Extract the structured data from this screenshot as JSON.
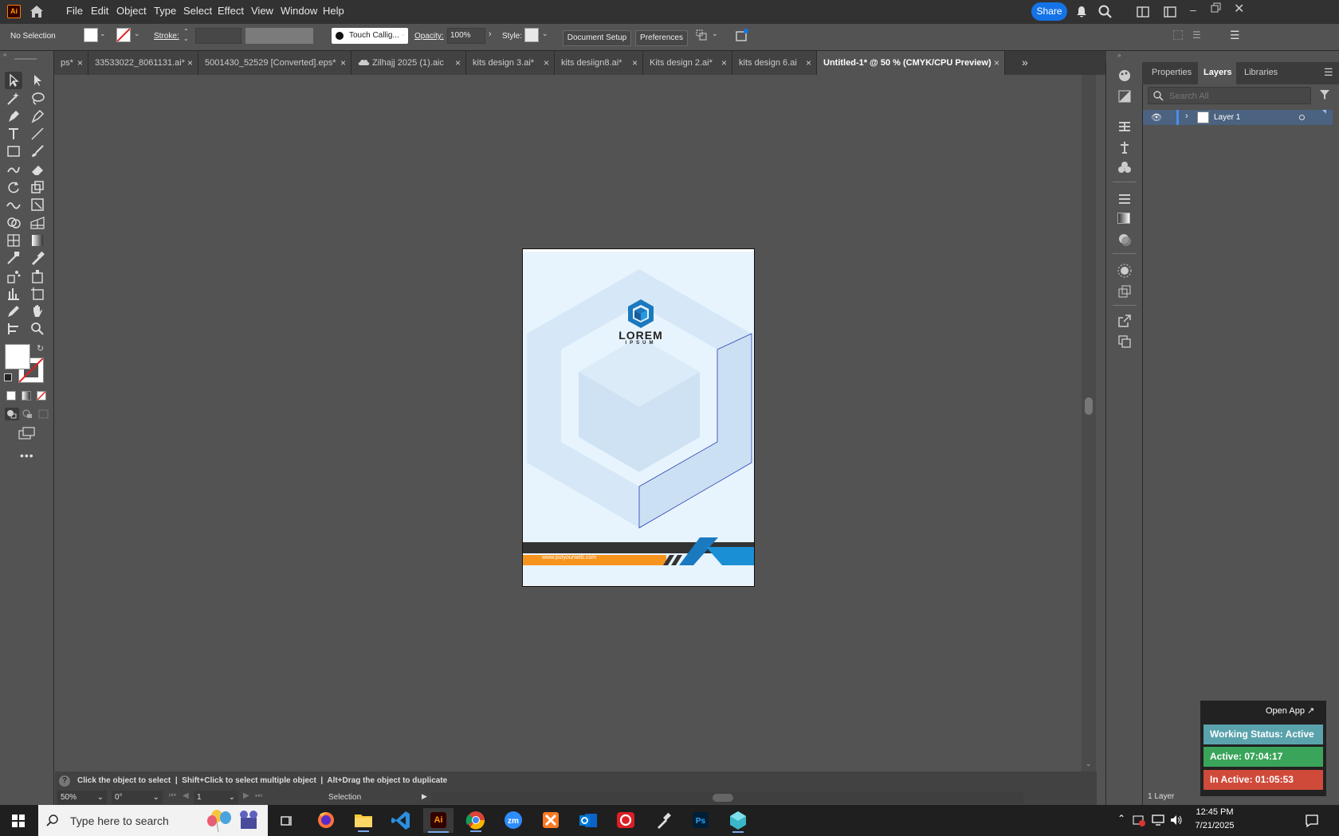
{
  "app": {
    "logo": "Ai"
  },
  "menu": [
    "File",
    "Edit",
    "Object",
    "Type",
    "Select",
    "Effect",
    "View",
    "Window",
    "Help"
  ],
  "header": {
    "share_label": "Share"
  },
  "control": {
    "selection": "No Selection",
    "stroke_label": "Stroke:",
    "brush": "Touch Callig...",
    "opacity_label": "Opacity:",
    "opacity_value": "100%",
    "style_label": "Style:",
    "doc_setup": "Document Setup",
    "preferences": "Preferences"
  },
  "tabs": [
    {
      "label": "ps*"
    },
    {
      "label": "33533022_8061131.ai*"
    },
    {
      "label": "5001430_52529 [Converted].eps*"
    },
    {
      "label": "Zilhajj 2025 (1).aic"
    },
    {
      "label": "kits design 3.ai*"
    },
    {
      "label": "kits desiign8.ai*"
    },
    {
      "label": "Kits design 2.ai*"
    },
    {
      "label": "kits design 6.ai"
    },
    {
      "label": "Untitled-1* @ 50 % (CMYK/CPU Preview)"
    }
  ],
  "artboard": {
    "logo_text_1": "LOREM",
    "logo_text_2": "IPSUM",
    "website": "www.putyourweb.com",
    "colors": {
      "bg": "#e8f4fd",
      "hex_light": "#d3e5f5",
      "blue": "#1b79c0",
      "orange": "#f7941d",
      "dark": "#333333"
    }
  },
  "status": {
    "hint": "Click the object to select  |  Shift+Click to select multiple object  |  Alt+Drag the object to duplicate",
    "zoom": "50%",
    "rotation": "0°",
    "artboard_num": "1",
    "tool": "Selection"
  },
  "panel": {
    "tabs": [
      "Properties",
      "Layers",
      "Libraries"
    ],
    "search_placeholder": "Search All",
    "layer_name": "Layer 1",
    "footer": "1 Layer"
  },
  "widget": {
    "open_app": "Open App ↗",
    "working": "Working Status: Active",
    "active": "Active: 07:04:17",
    "inactive": "In Active: 01:05:53"
  },
  "taskbar": {
    "search": "Type here to search",
    "time": "12:45 PM",
    "date": "7/21/2025"
  }
}
